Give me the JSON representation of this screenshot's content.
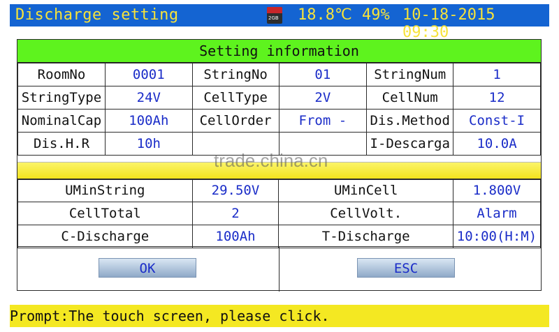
{
  "header": {
    "title": "Discharge setting",
    "sd_label": "2GB",
    "temperature": "18.8℃",
    "battery": "49%",
    "datetime": "10-18-2015 09:30"
  },
  "section_title": "Setting information",
  "info_rows": [
    [
      {
        "k": "RoomNo"
      },
      {
        "v": "0001"
      },
      {
        "k": "StringNo"
      },
      {
        "v": "01"
      },
      {
        "k": "StringNum"
      },
      {
        "v": "1"
      }
    ],
    [
      {
        "k": "StringType"
      },
      {
        "v": "24V"
      },
      {
        "k": "CellType"
      },
      {
        "v": "2V"
      },
      {
        "k": "CellNum"
      },
      {
        "v": "12"
      }
    ],
    [
      {
        "k": "NominalCap"
      },
      {
        "v": "100Ah"
      },
      {
        "k": "CellOrder"
      },
      {
        "v": "From -"
      },
      {
        "k": "Dis.Method"
      },
      {
        "v": "Const-I"
      }
    ],
    [
      {
        "k": "Dis.H.R"
      },
      {
        "v": "10h"
      },
      {
        "k": ""
      },
      {
        "v": ""
      },
      {
        "k": "I-Descarga"
      },
      {
        "v": "10.0A"
      }
    ]
  ],
  "limits_rows": [
    [
      {
        "k": "UMinString"
      },
      {
        "v": "29.50V"
      },
      {
        "k": "UMinCell"
      },
      {
        "v": "1.800V"
      }
    ],
    [
      {
        "k": "CellTotal"
      },
      {
        "v": "2"
      },
      {
        "k": "CellVolt."
      },
      {
        "v": "Alarm"
      }
    ],
    [
      {
        "k": "C-Discharge"
      },
      {
        "v": "100Ah"
      },
      {
        "k": "T-Discharge"
      },
      {
        "v": "10:00(H:M)"
      }
    ]
  ],
  "buttons": {
    "ok": "OK",
    "esc": "ESC"
  },
  "prompt": "Prompt:The touch screen, please click.",
  "watermark": "trade.china.cn"
}
